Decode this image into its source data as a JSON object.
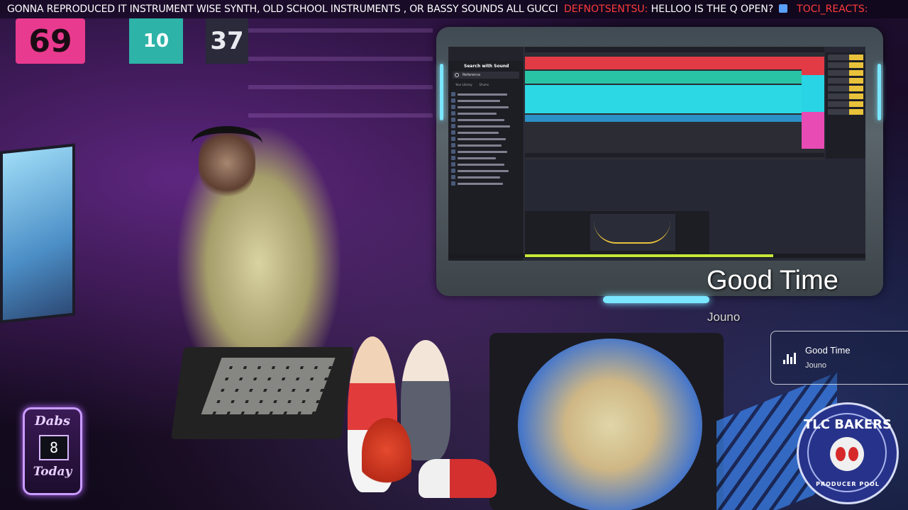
{
  "ticker": {
    "message": "GONNA REPRODUCED IT INSTRUMENT WISE SYNTH, OLD SCHOOL INSTRUMENTS , OR BASSY SOUNDS  ALL GUCCI",
    "user1": "DEFNOTSENTSU:",
    "chat1": "HELLOO IS THE Q OPEN?",
    "user2": "TOCI_REACTS:"
  },
  "jerseys": [
    "69",
    "10",
    "37"
  ],
  "daw": {
    "browser_title": "Search with Sound",
    "search_value": "Reference",
    "tabs": [
      "Your Library",
      "Drums"
    ]
  },
  "song": {
    "title": "Good Time",
    "artist": "Jouno"
  },
  "now_playing": {
    "title": "Good Time",
    "artist": "Jouno"
  },
  "dabs": {
    "top": "Dabs",
    "count": "8",
    "bottom": "Today"
  },
  "logo": {
    "top": "TLC BAKERS",
    "bottom": "PRODUCER POOL"
  },
  "colors": {
    "track_red": "#e23b45",
    "track_teal": "#29c4a6",
    "track_cyan": "#2bd8e4",
    "accent_glow": "#7be6ff",
    "badge_glow": "#b468ff"
  }
}
